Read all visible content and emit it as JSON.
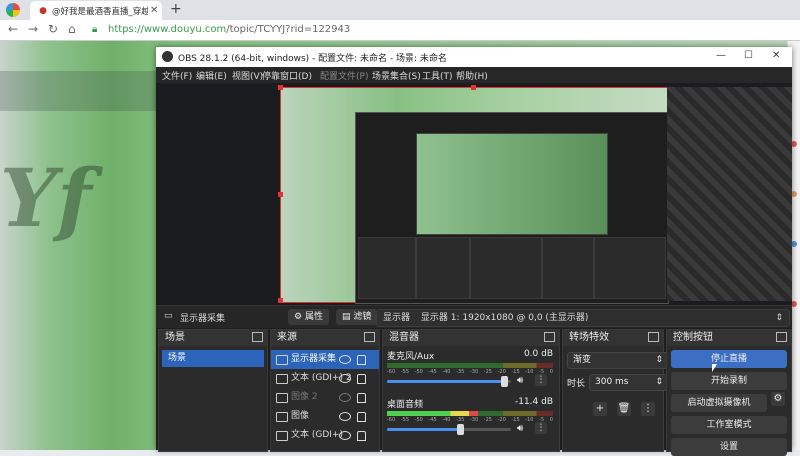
{
  "browser": {
    "tab_title": "@好我是最酒香直播_穿越火线",
    "url_scheme": "https://",
    "url_domain": "www.douyu.com",
    "url_path": "/topic/TCYYJ?rid=122943",
    "icons": [
      "browser-logo-icon",
      "back-icon",
      "forward-icon",
      "reload-icon",
      "home-icon",
      "lock-icon"
    ]
  },
  "obs": {
    "title": "OBS 28.1.2 (64-bit, windows) - 配置文件: 未命名 - 场景: 未命名",
    "menus": [
      {
        "label": "文件(F)"
      },
      {
        "label": "编辑(E)"
      },
      {
        "label": "视图(V)"
      },
      {
        "label": "停靠窗口(D)"
      },
      {
        "label": "配置文件(P)"
      },
      {
        "label": "场景集合(S)"
      },
      {
        "label": "工具(T)"
      },
      {
        "label": "帮助(H)"
      }
    ],
    "toolbar": {
      "source_name": "显示器采集",
      "properties": "属性",
      "filters": "滤镜",
      "display_label": "显示器",
      "display_value": "显示器 1: 1920x1080 @ 0,0 (主显示器)"
    },
    "scenes": {
      "title": "场景",
      "items": [
        "场景"
      ]
    },
    "sources": {
      "title": "来源",
      "items": [
        {
          "name": "显示器采集"
        },
        {
          "name": "文本 (GDI+) 2"
        },
        {
          "name": "图像 2"
        },
        {
          "name": "图像"
        },
        {
          "name": "文本 (GDI+)"
        }
      ]
    },
    "mixer": {
      "title": "混音器",
      "ticks": [
        "-60",
        "-55",
        "-50",
        "-45",
        "-40",
        "-35",
        "-30",
        "-25",
        "-20",
        "-15",
        "-10",
        "-5",
        "0"
      ],
      "channels": [
        {
          "name": "麦克风/Aux",
          "db": "0.0 dB",
          "level": 0.0,
          "volume": 0.95
        },
        {
          "name": "桌面音频",
          "db": "-11.4 dB",
          "level": 0.55,
          "volume": 0.6
        }
      ]
    },
    "transitions": {
      "title": "转场特效",
      "type": "渐变",
      "duration_label": "时长",
      "duration_value": "300 ms"
    },
    "controls": {
      "title": "控制按钮",
      "buttons": [
        "停止直播",
        "开始录制",
        "启动虚拟摄像机",
        "工作室模式",
        "设置"
      ]
    }
  }
}
